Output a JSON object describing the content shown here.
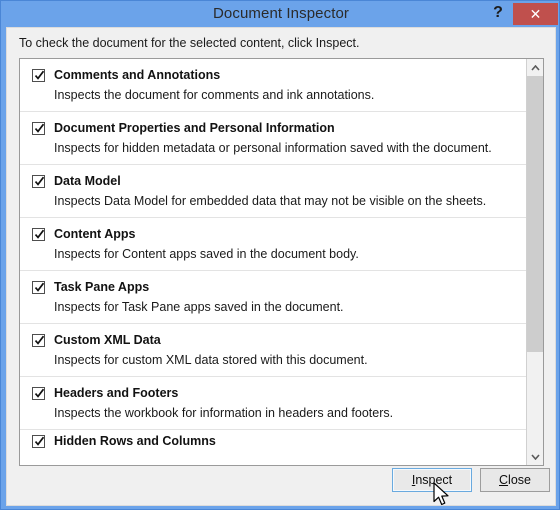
{
  "window": {
    "title": "Document Inspector",
    "help_label": "?",
    "close_label": "✕"
  },
  "body": {
    "instruction": "To check the document for the selected content, click Inspect."
  },
  "list": {
    "items": [
      {
        "checked": true,
        "title": "Comments and Annotations",
        "description": "Inspects the document for comments and ink annotations."
      },
      {
        "checked": true,
        "title": "Document Properties and Personal Information",
        "description": "Inspects for hidden metadata or personal information saved with the document."
      },
      {
        "checked": true,
        "title": "Data Model",
        "description": "Inspects Data Model for embedded data that may not be visible on the sheets."
      },
      {
        "checked": true,
        "title": "Content Apps",
        "description": "Inspects for Content apps saved in the document body."
      },
      {
        "checked": true,
        "title": "Task Pane Apps",
        "description": "Inspects for Task Pane apps saved in the document."
      },
      {
        "checked": true,
        "title": "Custom XML Data",
        "description": "Inspects for custom XML data stored with this document."
      },
      {
        "checked": true,
        "title": "Headers and Footers",
        "description": "Inspects the workbook for information in headers and footers."
      },
      {
        "checked": true,
        "title": "Hidden Rows and Columns",
        "description": ""
      }
    ]
  },
  "scrollbar": {
    "up_arrow": "˄",
    "down_arrow": "˅"
  },
  "footer": {
    "inspect_label": "Inspect",
    "inspect_accel": "I",
    "inspect_rest": "nspect",
    "close_label": "Close",
    "close_accel": "C",
    "close_rest": "lose"
  },
  "colors": {
    "titlebar": "#6ba3ea",
    "close_button": "#c0504d",
    "panel": "#f0f0f0",
    "list_background": "#ffffff",
    "focus_border": "#6aaadf"
  }
}
